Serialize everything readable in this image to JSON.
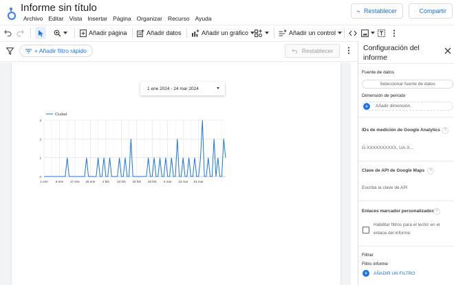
{
  "app": {
    "title": "Informe sin título",
    "menu": [
      "Archivo",
      "Editar",
      "Vista",
      "Insertar",
      "Página",
      "Organizar",
      "Recurso",
      "Ayuda"
    ],
    "reset_label": "Restablecer",
    "share_label": "Compartir"
  },
  "toolbar": {
    "add_page": "Añadir página",
    "add_data": "Añadir datos",
    "add_chart": "Añadir un gráfico",
    "add_control": "Añadir un control"
  },
  "filterbar": {
    "add_filter": "+ Añadir filtro rápido",
    "reset_label": "Restablecer"
  },
  "report": {
    "date_range": "1 ene 2024 - 24 mar 2024"
  },
  "chart_data": {
    "type": "line",
    "series": [
      {
        "name": "Ciudad",
        "values": [
          0,
          0,
          0,
          0,
          0,
          0,
          0,
          0,
          0,
          0,
          0,
          0,
          1,
          0,
          0,
          0,
          0,
          0,
          0,
          0,
          0,
          0,
          1,
          0,
          0,
          0,
          0,
          0,
          1,
          0,
          0,
          1,
          0,
          0,
          1,
          0,
          0,
          0,
          0,
          1,
          0,
          0,
          1,
          0,
          0,
          2,
          0,
          0,
          0,
          0,
          0,
          0,
          0,
          0,
          1,
          0,
          0,
          1,
          0,
          0,
          1,
          0,
          0,
          1,
          0,
          0,
          1,
          0,
          0,
          2,
          0,
          0,
          1,
          0,
          0,
          1,
          0,
          0,
          1,
          0,
          0,
          1,
          3,
          0,
          0,
          1,
          0,
          0,
          2,
          0,
          1,
          0,
          0,
          2,
          1
        ]
      }
    ],
    "xticks": [
      "1 ene",
      "9 ene",
      "17 ene",
      "25 ene",
      "2 feb",
      "10 feb",
      "18 feb",
      "26 feb",
      "5 mar",
      "13 mar",
      "21 mar"
    ],
    "yticks": [
      "0",
      "1",
      "2",
      "3"
    ],
    "ylim": [
      0,
      3
    ],
    "color": "#1a73e8",
    "grid": true,
    "legend": "top-left"
  },
  "panel": {
    "title": "Configuración del informe",
    "data_source_label": "Fuente de datos",
    "select_source": "Seleccionar fuente de datos",
    "period_dimension_label": "Dimensión de periodo",
    "add_dimension": "Añadir dimensión",
    "ga_ids_label": "IDs de medición de Google Analytics",
    "ga_ids_placeholder": "G-XXXXXXXXXX, UA-X...",
    "maps_key_label": "Clave de API de Google Maps",
    "maps_key_placeholder": "Escriba la clave de API",
    "bookmark_label": "Enlaces marcador personalizados",
    "bookmark_option": "Habilitar filtros para el lector en el enlace del informe",
    "filter_section": "Filtrar",
    "report_filter": "Filtro informe",
    "add_filter": "AÑADIR UN FILTRO"
  },
  "colors": {
    "accent": "#1a73e8",
    "text": "#202124",
    "border": "#dadce0"
  }
}
